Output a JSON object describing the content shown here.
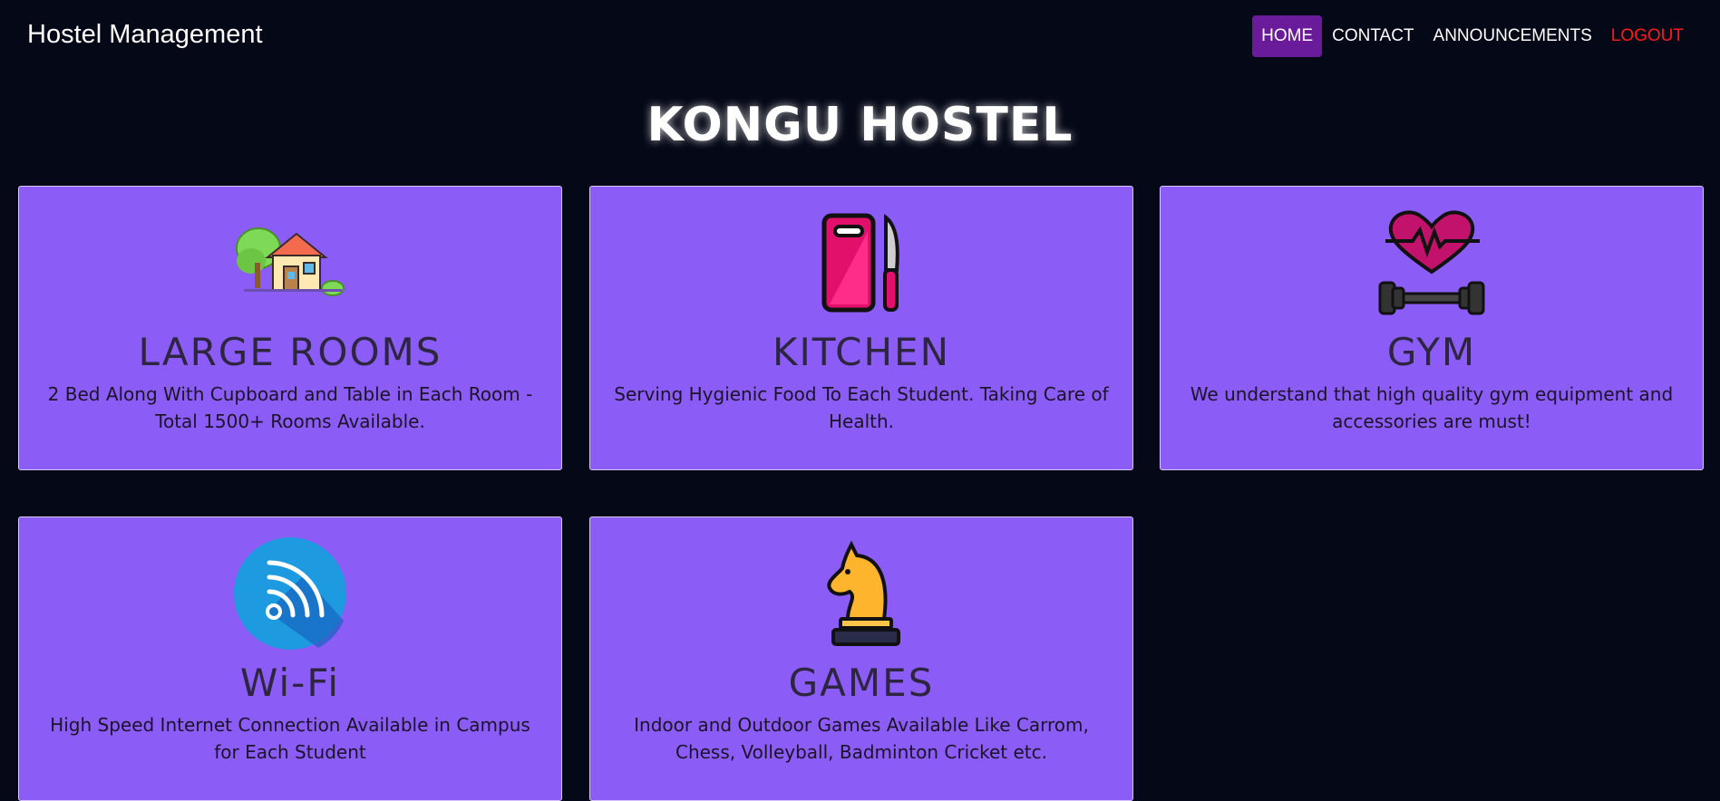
{
  "navbar": {
    "brand": "Hostel Management",
    "links": [
      {
        "label": "HOME",
        "active": true
      },
      {
        "label": "CONTACT",
        "active": false
      },
      {
        "label": "ANNOUNCEMENTS",
        "active": false
      },
      {
        "label": "LOGOUT",
        "active": false
      }
    ]
  },
  "page_title": "KONGU HOSTEL",
  "cards": [
    {
      "icon": "house-icon",
      "title": "LARGE ROOMS",
      "description": "2 Bed Along With Cupboard and Table in Each Room - Total 1500+ Rooms Available."
    },
    {
      "icon": "kitchen-icon",
      "title": "KITCHEN",
      "description": "Serving Hygienic Food To Each Student. Taking Care of Health."
    },
    {
      "icon": "gym-icon",
      "title": "GYM",
      "description": "We understand that high quality gym equipment and accessories are must!"
    },
    {
      "icon": "wifi-icon",
      "title": "Wi-Fi",
      "description": "High Speed Internet Connection Available in Campus for Each Student"
    },
    {
      "icon": "chess-knight-icon",
      "title": "GAMES",
      "description": "Indoor and Outdoor Games Available Like Carrom, Chess, Volleyball, Badminton Cricket etc."
    }
  ],
  "colors": {
    "background": "#050816",
    "card": "#8b5cf6",
    "active_nav": "#6a1b9a",
    "logout": "#ff1a1a"
  }
}
